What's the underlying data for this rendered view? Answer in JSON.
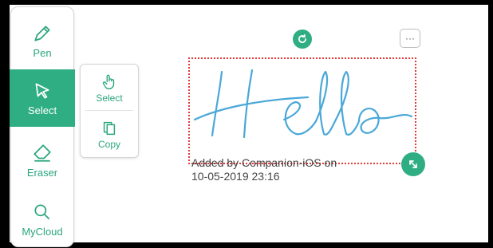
{
  "toolbar": {
    "items": [
      {
        "label": "Pen",
        "icon": "pen-icon"
      },
      {
        "label": "Select",
        "icon": "select-arrow-icon",
        "active": true
      },
      {
        "label": "Eraser",
        "icon": "eraser-icon"
      },
      {
        "label": "MyCloud",
        "icon": "search-cloud-icon"
      }
    ]
  },
  "submenu": {
    "items": [
      {
        "label": "Select",
        "icon": "hand-pointer-icon"
      },
      {
        "label": "Copy",
        "icon": "copy-icon"
      }
    ]
  },
  "canvas": {
    "handwriting_text": "Hello",
    "caption_line1": "Added by Companion-iOS on",
    "caption_line2": "10-05-2019 23:16",
    "more_label": "···"
  },
  "colors": {
    "accent": "#2fae83",
    "ink": "#4aa8d8",
    "selection_border": "#e23b3b"
  }
}
